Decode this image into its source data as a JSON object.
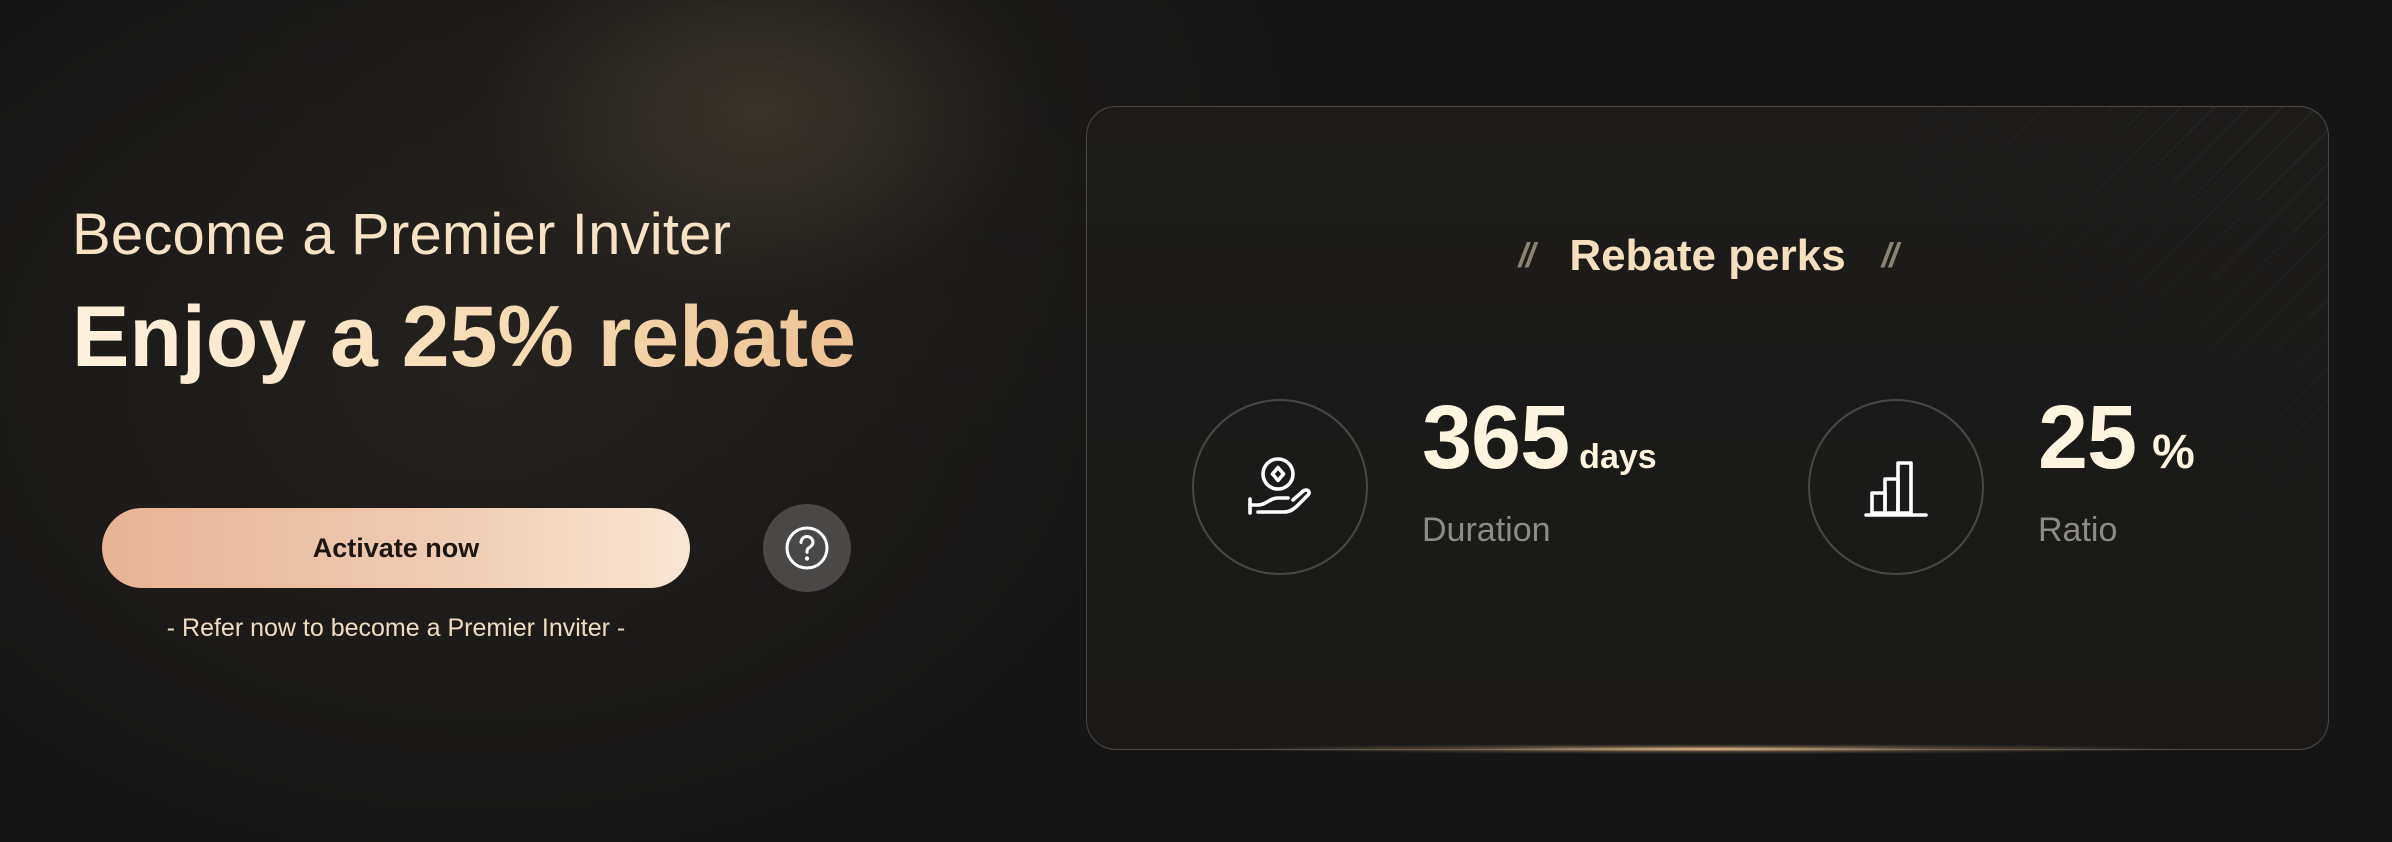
{
  "hero": {
    "subtitle": "Become a Premier Inviter",
    "title": "Enjoy a 25% rebate",
    "activate_label": "Activate now",
    "help_icon": "question-circle-icon",
    "refer_note": "- Refer now to become a Premier Inviter -"
  },
  "card": {
    "quote_open": "//",
    "title": "Rebate perks",
    "quote_close": "//",
    "perks": [
      {
        "icon": "coin-hand-icon",
        "value": "365",
        "unit": "days",
        "label": "Duration"
      },
      {
        "icon": "bar-chart-icon",
        "value": "25",
        "unit": "%",
        "label": "Ratio"
      }
    ]
  },
  "colors": {
    "background": "#161616",
    "accent_gold": "#f6dfbd",
    "button_gradient_start": "#e8b395",
    "button_gradient_end": "#f8e6d4",
    "muted_label": "#8e8a84"
  }
}
